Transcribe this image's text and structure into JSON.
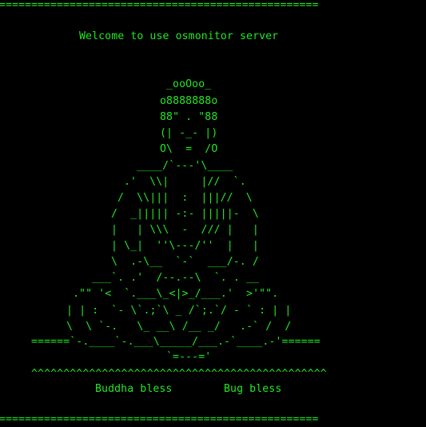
{
  "terminal": {
    "top_rule": "==================================================",
    "welcome": "Welcome to use osmonitor server",
    "art": [
      "_ooOoo_",
      "o8888888o",
      "88\" . \"88",
      "(| -_- |)",
      "O\\  =  /O",
      "____/`---'\\____",
      ".'  \\\\|     |//  `.",
      "/  \\\\|||  :  |||//  \\",
      "/  _||||| -:- |||||-  \\",
      "|   | \\\\\\  -  /// |   |",
      "| \\_|  ''\\---/''  |   |",
      "\\  .-\\__  `-`  ___/-. /",
      "___`. .'  /--.--\\  `. . __",
      ".\"\" '<  `.___\\_<|>_/___.'  >'\"\".",
      "| | :  `- \\`.;`\\ _ /`;.`/ - ` : | |",
      "\\  \\ `-.   \\_ __\\ /__ _/   .-` /  /",
      "======`-.____`-.___\\_____/___.-`____.-'======",
      "`=---='",
      "^^^^^^^^^^^^^^^^^^^^^^^^^^^^^^^^^^^^^^^^^^^^^^"
    ],
    "blessing_1": "Buddha bless",
    "blessing_2": "Bug bless",
    "bottom_rule": "=================================================="
  },
  "colors": {
    "background": "#000000",
    "text": "#22e622"
  }
}
